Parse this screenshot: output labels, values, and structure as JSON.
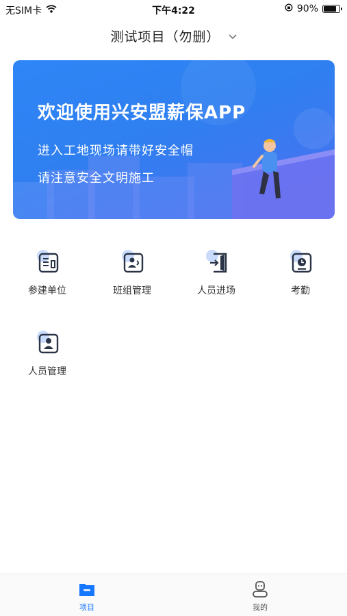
{
  "status_bar": {
    "carrier": "无SIM卡",
    "time": "下午4:22",
    "battery": "90%",
    "battery_level": 0.9
  },
  "header": {
    "title": "测试项目（勿删）"
  },
  "banner": {
    "title": "欢迎使用兴安盟薪保APP",
    "line1": "进入工地现场请带好安全帽",
    "line2": "请注意安全文明施工"
  },
  "menu": {
    "items": [
      {
        "label": "参建单位",
        "icon": "building-icon"
      },
      {
        "label": "班组管理",
        "icon": "team-icon"
      },
      {
        "label": "人员进场",
        "icon": "entry-door-icon"
      },
      {
        "label": "考勤",
        "icon": "clock-icon"
      },
      {
        "label": "人员管理",
        "icon": "person-card-icon"
      }
    ]
  },
  "tab_bar": {
    "tabs": [
      {
        "label": "项目",
        "icon": "folder-icon",
        "active": true
      },
      {
        "label": "我的",
        "icon": "user-icon",
        "active": false
      }
    ]
  },
  "colors": {
    "accent": "#1677ff",
    "icon_stroke": "#2a3446",
    "icon_blob": "#c9dbfb",
    "tab_inactive": "#555555"
  }
}
